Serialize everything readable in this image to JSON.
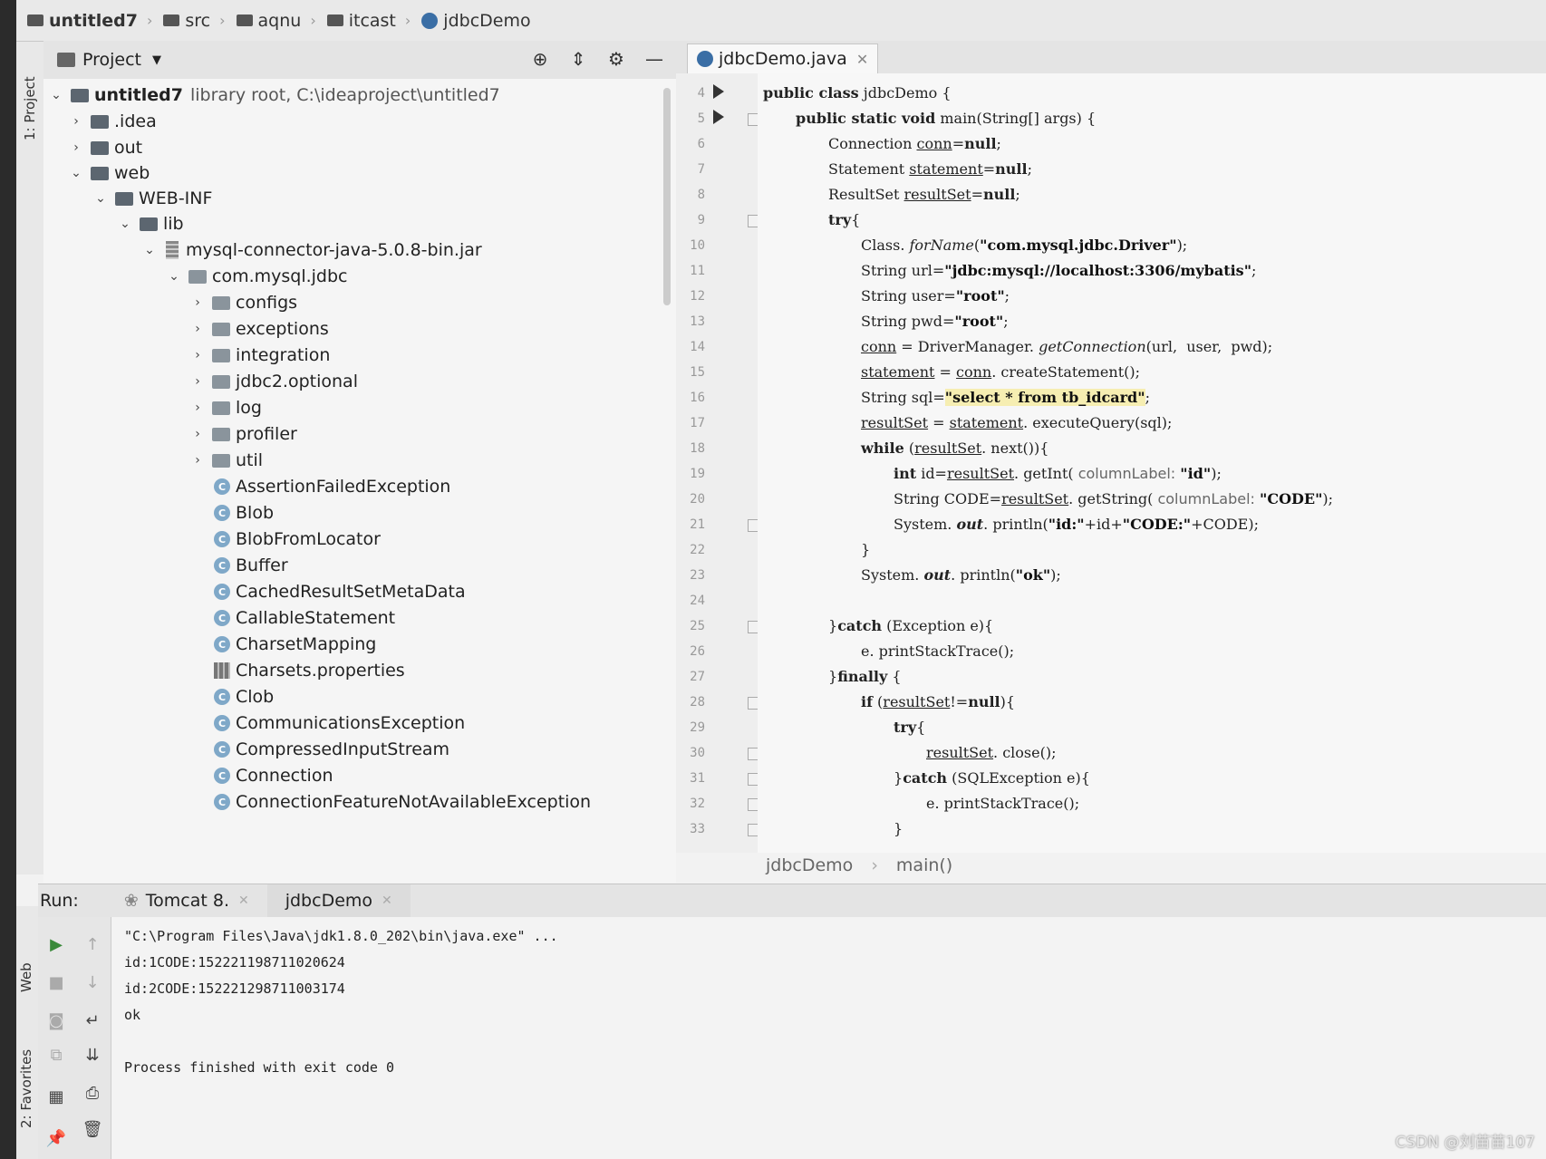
{
  "breadcrumb": {
    "project": "untitled7",
    "items": [
      "src",
      "aqnu",
      "itcast",
      "jdbcDemo"
    ]
  },
  "sidebar": {
    "top_label": "1: Project",
    "web_label": "Web",
    "favorites_label": "2: Favorites"
  },
  "project_panel": {
    "title": "Project",
    "root_name": "untitled7",
    "root_detail": "library root,  C:\\ideaproject\\untitled7",
    "items": [
      {
        "label": ".idea",
        "icon": "folder-icon"
      },
      {
        "label": "out",
        "icon": "folder-icon"
      },
      {
        "label": "web",
        "icon": "folder-icon"
      },
      {
        "label": "WEB-INF",
        "icon": "folder-icon"
      },
      {
        "label": "lib",
        "icon": "folder-icon"
      },
      {
        "label": "mysql-connector-java-5.0.8-bin.jar",
        "icon": "jar-icon"
      },
      {
        "label": "com.mysql.jdbc",
        "icon": "package-icon"
      },
      {
        "label": "configs",
        "icon": "package-icon"
      },
      {
        "label": "exceptions",
        "icon": "package-icon"
      },
      {
        "label": "integration",
        "icon": "package-icon"
      },
      {
        "label": "jdbc2.optional",
        "icon": "package-icon"
      },
      {
        "label": "log",
        "icon": "package-icon"
      },
      {
        "label": "profiler",
        "icon": "package-icon"
      },
      {
        "label": "util",
        "icon": "package-icon"
      },
      {
        "label": "AssertionFailedException",
        "icon": "class-icon"
      },
      {
        "label": "Blob",
        "icon": "class-icon"
      },
      {
        "label": "BlobFromLocator",
        "icon": "class-icon"
      },
      {
        "label": "Buffer",
        "icon": "class-icon"
      },
      {
        "label": "CachedResultSetMetaData",
        "icon": "class-icon"
      },
      {
        "label": "CallableStatement",
        "icon": "class-icon"
      },
      {
        "label": "CharsetMapping",
        "icon": "class-icon"
      },
      {
        "label": "Charsets.properties",
        "icon": "properties-icon"
      },
      {
        "label": "Clob",
        "icon": "class-icon"
      },
      {
        "label": "CommunicationsException",
        "icon": "class-icon"
      },
      {
        "label": "CompressedInputStream",
        "icon": "class-icon"
      },
      {
        "label": "Connection",
        "icon": "class-icon"
      },
      {
        "label": "ConnectionFeatureNotAvailableException",
        "icon": "class-icon"
      }
    ]
  },
  "editor": {
    "tab_label": "jdbcDemo.java",
    "line_numbers": [
      "4",
      "5",
      "6",
      "7",
      "8",
      "9",
      "10",
      "11",
      "12",
      "13",
      "14",
      "15",
      "16",
      "17",
      "18",
      "19",
      "20",
      "21",
      "22",
      "23",
      "24",
      "25",
      "26",
      "27",
      "28",
      "29",
      "30",
      "31",
      "32",
      "33"
    ],
    "code": {
      "l4a": "public class",
      "l4b": " jdbcDemo {",
      "l5a": "public static void",
      "l5b": " main(String[] args) {",
      "l6a": "Connection ",
      "l6b": "conn",
      "l6c": "=",
      "l6d": "null",
      "l6e": ";",
      "l7a": "Statement ",
      "l7b": "statement",
      "l7c": "=",
      "l7d": "null",
      "l7e": ";",
      "l8a": "ResultSet ",
      "l8b": "resultSet",
      "l8c": "=",
      "l8d": "null",
      "l8e": ";",
      "l9a": "try",
      "l9b": "{",
      "l10a": "Class. ",
      "l10b": "forName",
      "l10c": "(",
      "l10d": "\"com.mysql.jdbc.Driver\"",
      "l10e": ");",
      "l11a": "String url=",
      "l11b": "\"jdbc:mysql://localhost:3306/mybatis\"",
      "l11c": ";",
      "l12a": "String user=",
      "l12b": "\"root\"",
      "l12c": ";",
      "l13a": "String pwd=",
      "l13b": "\"root\"",
      "l13c": ";",
      "l14a": "conn",
      "l14b": " = DriverManager. ",
      "l14c": "getConnection",
      "l14d": "(url,  user,  pwd);",
      "l15a": "statement",
      "l15b": " = ",
      "l15c": "conn",
      "l15d": ". createStatement();",
      "l16a": "String sql=",
      "l16b": "\"select * from tb_idcard\"",
      "l16c": ";",
      "l17a": "resultSet",
      "l17b": " = ",
      "l17c": "statement",
      "l17d": ". executeQuery(sql);",
      "l18a": "while",
      "l18b": " (",
      "l18c": "resultSet",
      "l18d": ". next()){",
      "l19a": "int",
      "l19b": " id=",
      "l19c": "resultSet",
      "l19d": ". getInt( ",
      "l19e": "columnLabel:",
      "l19f": " ",
      "l19g": "\"id\"",
      "l19h": ");",
      "l20a": "String CODE=",
      "l20b": "resultSet",
      "l20c": ". getString( ",
      "l20d": "columnLabel:",
      "l20e": " ",
      "l20f": "\"CODE\"",
      "l20g": ");",
      "l21a": "System. ",
      "l21b": "out",
      "l21c": ". println(",
      "l21d": "\"id:\"",
      "l21e": "+id+",
      "l21f": "\"CODE:\"",
      "l21g": "+CODE);",
      "l22a": "}",
      "l23a": "System. ",
      "l23b": "out",
      "l23c": ". println(",
      "l23d": "\"ok\"",
      "l23e": ");",
      "l25a": "}",
      "l25b": "catch",
      "l25c": " (Exception e){",
      "l26a": "e. printStackTrace();",
      "l27a": "}",
      "l27b": "finally",
      "l27c": " {",
      "l28a": "if",
      "l28b": " (",
      "l28c": "resultSet",
      "l28d": "!=",
      "l28e": "null",
      "l28f": "){",
      "l29a": "try",
      "l29b": "{",
      "l30a": "resultSet",
      "l30b": ". close();",
      "l31a": "}",
      "l31b": "catch",
      "l31c": " (SQLException e){",
      "l32a": "e. printStackTrace();",
      "l33a": "}"
    },
    "breadcrumb_class": "jdbcDemo",
    "breadcrumb_method": "main()"
  },
  "run": {
    "label": "Run:",
    "tabs": [
      "Tomcat 8.",
      "jdbcDemo"
    ],
    "console": [
      "\"C:\\Program Files\\Java\\jdk1.8.0_202\\bin\\java.exe\" ...",
      "id:1CODE:152221198711020624",
      "id:2CODE:152221298711003174",
      "ok",
      "Process finished with exit code 0"
    ]
  },
  "watermark": "CSDN @刘苗苗107"
}
